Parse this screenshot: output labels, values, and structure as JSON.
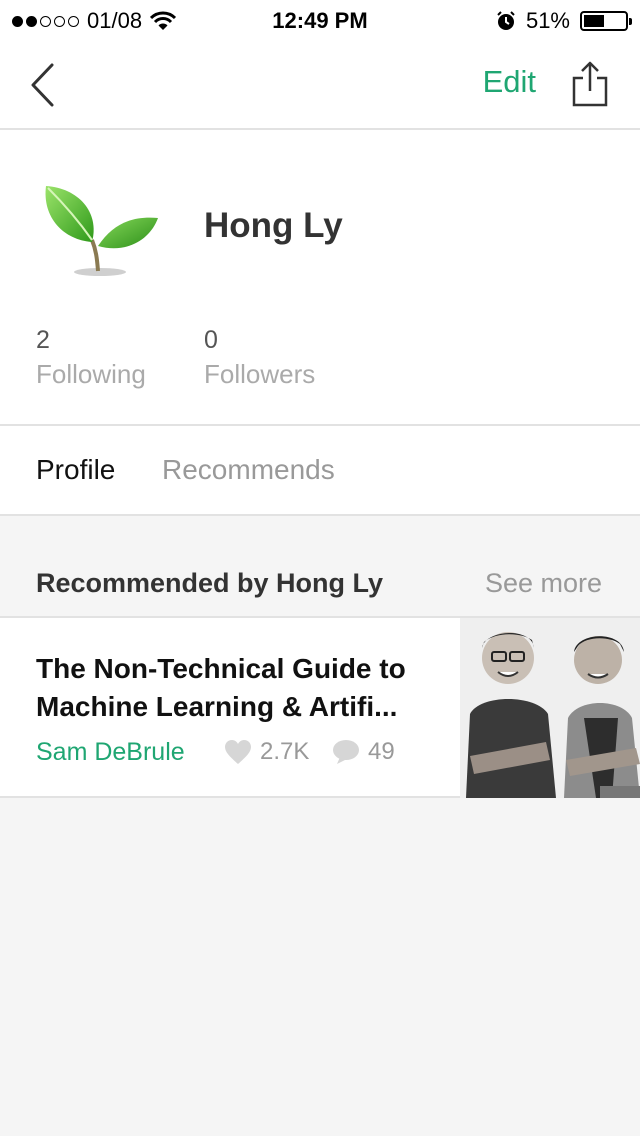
{
  "status_bar": {
    "carrier": "01/08",
    "time": "12:49 PM",
    "battery": "51%",
    "battery_level": 0.51
  },
  "nav": {
    "edit_label": "Edit"
  },
  "profile": {
    "name": "Hong Ly",
    "following_count": "2",
    "following_label": "Following",
    "followers_count": "0",
    "followers_label": "Followers"
  },
  "tabs": [
    {
      "label": "Profile",
      "active": true
    },
    {
      "label": "Recommends",
      "active": false
    }
  ],
  "recommended": {
    "title": "Recommended by Hong Ly",
    "see_more_label": "See more",
    "story": {
      "title": "The Non-Technical Guide to Machine Learning & Artifi...",
      "author": "Sam DeBrule",
      "likes": "2.7K",
      "comments": "49"
    }
  },
  "colors": {
    "accent": "#1fa672",
    "muted": "#999999",
    "background": "#f5f5f5"
  },
  "icons": [
    "wifi-icon",
    "alarm-icon",
    "battery-icon",
    "back-chevron-icon",
    "share-icon",
    "heart-icon",
    "comment-icon"
  ]
}
